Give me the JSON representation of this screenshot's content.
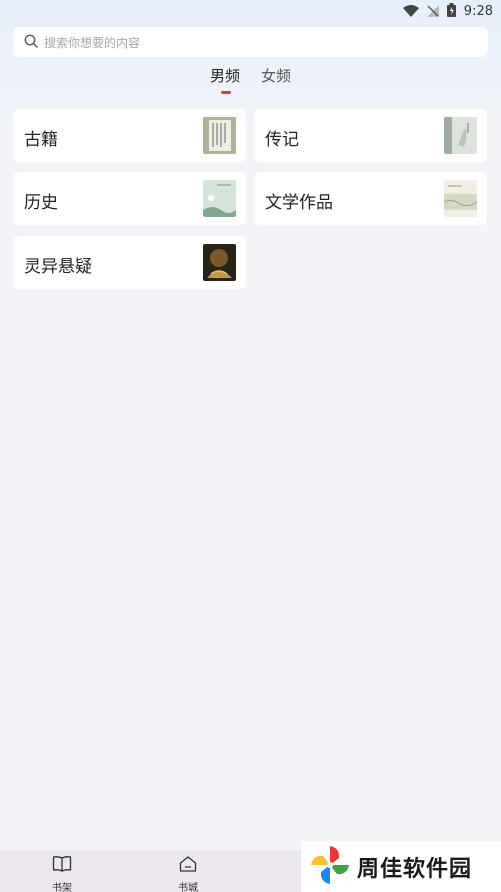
{
  "status_bar": {
    "time": "9:28"
  },
  "search": {
    "placeholder": "搜索你想要的内容"
  },
  "tabs": [
    {
      "label": "男频",
      "active": true
    },
    {
      "label": "女频",
      "active": false
    }
  ],
  "categories": [
    {
      "label": "古籍"
    },
    {
      "label": "传记"
    },
    {
      "label": "历史"
    },
    {
      "label": "文学作品"
    },
    {
      "label": "灵异悬疑"
    }
  ],
  "bottom_nav": [
    {
      "label": "书架",
      "icon": "book-open-icon"
    },
    {
      "label": "书城",
      "icon": "store-icon"
    }
  ],
  "watermark": {
    "text": "周佳软件园"
  },
  "colors": {
    "accent": "#e0383e",
    "background": "#f3f4f8"
  }
}
